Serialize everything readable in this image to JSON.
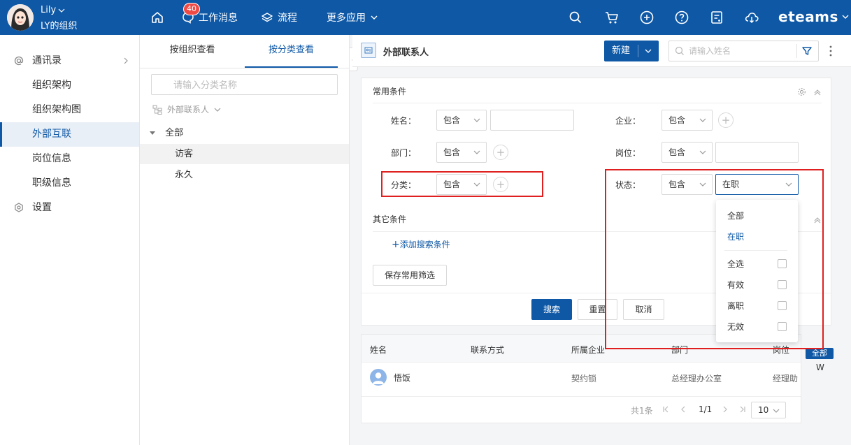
{
  "topbar": {
    "user_name": "Lily",
    "org_name": "LY的组织",
    "messages_label": "工作消息",
    "messages_badge": "40",
    "workflow_label": "流程",
    "more_apps_label": "更多应用",
    "brand": "eteams"
  },
  "leftnav": {
    "items": [
      {
        "label": "通讯录",
        "icon": "at-icon"
      },
      {
        "label": "组织架构"
      },
      {
        "label": "组织架构图"
      },
      {
        "label": "外部互联",
        "active": true
      },
      {
        "label": "岗位信息"
      },
      {
        "label": "职级信息"
      },
      {
        "label": "设置",
        "icon": "hexagon-settings-icon"
      }
    ]
  },
  "midpanel": {
    "tabs": [
      "按组织查看",
      "按分类查看"
    ],
    "active_tab": 1,
    "search_placeholder": "请输入分类名称",
    "root_label": "外部联系人",
    "tree": [
      {
        "label": "全部",
        "expanded": true
      },
      {
        "label": "访客",
        "selected": true
      },
      {
        "label": "永久"
      }
    ]
  },
  "content": {
    "title": "外部联系人",
    "new_button": "新建",
    "search_placeholder": "请输入姓名"
  },
  "filter": {
    "common_title": "常用条件",
    "other_title": "其它条件",
    "add_condition": "添加搜索条件",
    "save_button": "保存常用筛选",
    "search_button": "搜索",
    "reset_button": "重置",
    "cancel_button": "取消",
    "fields": {
      "name": {
        "label": "姓名：",
        "op": "包含"
      },
      "company": {
        "label": "企业：",
        "op": "包含"
      },
      "dept": {
        "label": "部门：",
        "op": "包含"
      },
      "position": {
        "label": "岗位：",
        "op": "包含"
      },
      "category": {
        "label": "分类：",
        "op": "包含"
      },
      "status": {
        "label": "状态：",
        "op": "包含",
        "value": "在职"
      }
    }
  },
  "status_dropdown": {
    "options": [
      "全部",
      "在职"
    ],
    "selected": "在职",
    "select_all": "全选",
    "checkbox_options": [
      "有效",
      "离职",
      "无效"
    ]
  },
  "table": {
    "headers": [
      "姓名",
      "联系方式",
      "所属企业",
      "部门",
      "岗位"
    ],
    "rows": [
      {
        "name": "悟饭",
        "contact": "",
        "company": "契约锁",
        "dept": "总经理办公室",
        "position": "经理助"
      }
    ],
    "total": "共1条",
    "page": "1/1",
    "page_size": "10"
  },
  "overlay": {
    "tag": "全部",
    "letter": "W"
  },
  "colors": {
    "accent": "#0e58a6",
    "highlight": "#e02020",
    "badge": "#f04a45"
  }
}
